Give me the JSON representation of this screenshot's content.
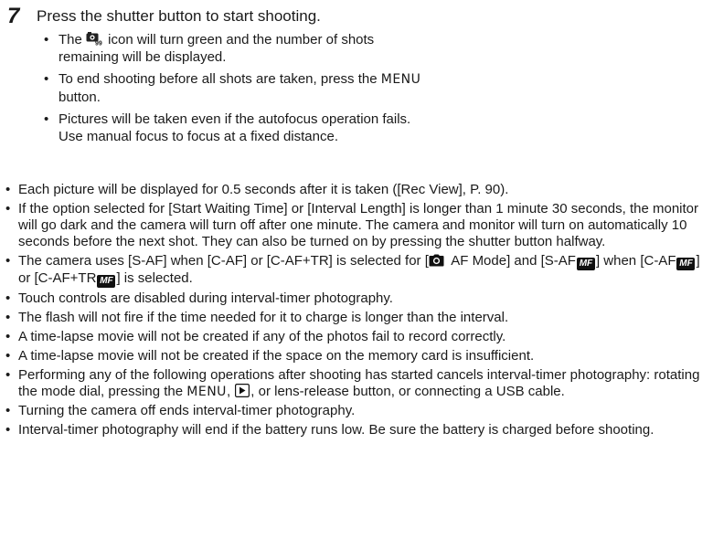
{
  "step": {
    "number": "7",
    "title": "Press the shutter button to start shooting.",
    "bullets": [
      {
        "pre": "The ",
        "post": " icon will turn green and the number of shots remaining will be displayed."
      },
      {
        "pre": "To end shooting before all shots are taken, press the ",
        "menu": "MENU",
        "post": " button."
      },
      {
        "text": "Pictures will be taken even if the autofocus operation fails. Use manual focus to focus at a fixed distance."
      }
    ]
  },
  "notes": {
    "bullet": "•",
    "n1": "Each picture will be displayed for 0.5 seconds after it is taken ([Rec View], P. 90).",
    "n2": "If the option selected for [Start Waiting Time] or [Interval Length] is longer than 1 minute 30 seconds, the monitor will go dark and the camera will turn off after one minute. The camera and monitor will turn on automatically 10 seconds before the next shot. They can also be turned on by pressing the shutter button halfway.",
    "n3": {
      "a": "The camera uses [S-AF] when [C-AF] or [C-AF+TR] is selected for [",
      "b": " AF Mode] and [S-AF",
      "c": "] when [C-AF",
      "d": "] or [C-AF+TR",
      "e": "] is selected."
    },
    "n4": "Touch controls are disabled during interval-timer photography.",
    "n5": "The flash will not fire if the time needed for it to charge is longer than the interval.",
    "n6": "A time-lapse movie will not be created if any of the photos fail to record correctly.",
    "n7": "A time-lapse movie will not be created if the space on the memory card is insufficient.",
    "n8": {
      "a": "Performing any of the following operations after shooting has started cancels interval-timer photography: rotating the mode dial, pressing the ",
      "menu": "MENU",
      "b": ", ",
      "c": ", or lens-release button, or connecting a USB cable."
    },
    "n9": "Turning the camera off ends interval-timer photography.",
    "n10": "Interval-timer photography will end if the battery runs low. Be sure the battery is charged before shooting."
  },
  "icons": {
    "mf_label": "MF",
    "interval_icon": "interval-shooting-icon",
    "camera_icon": "camera-icon",
    "play_icon": "playback-icon",
    "mf_icon": "manual-focus-icon"
  }
}
